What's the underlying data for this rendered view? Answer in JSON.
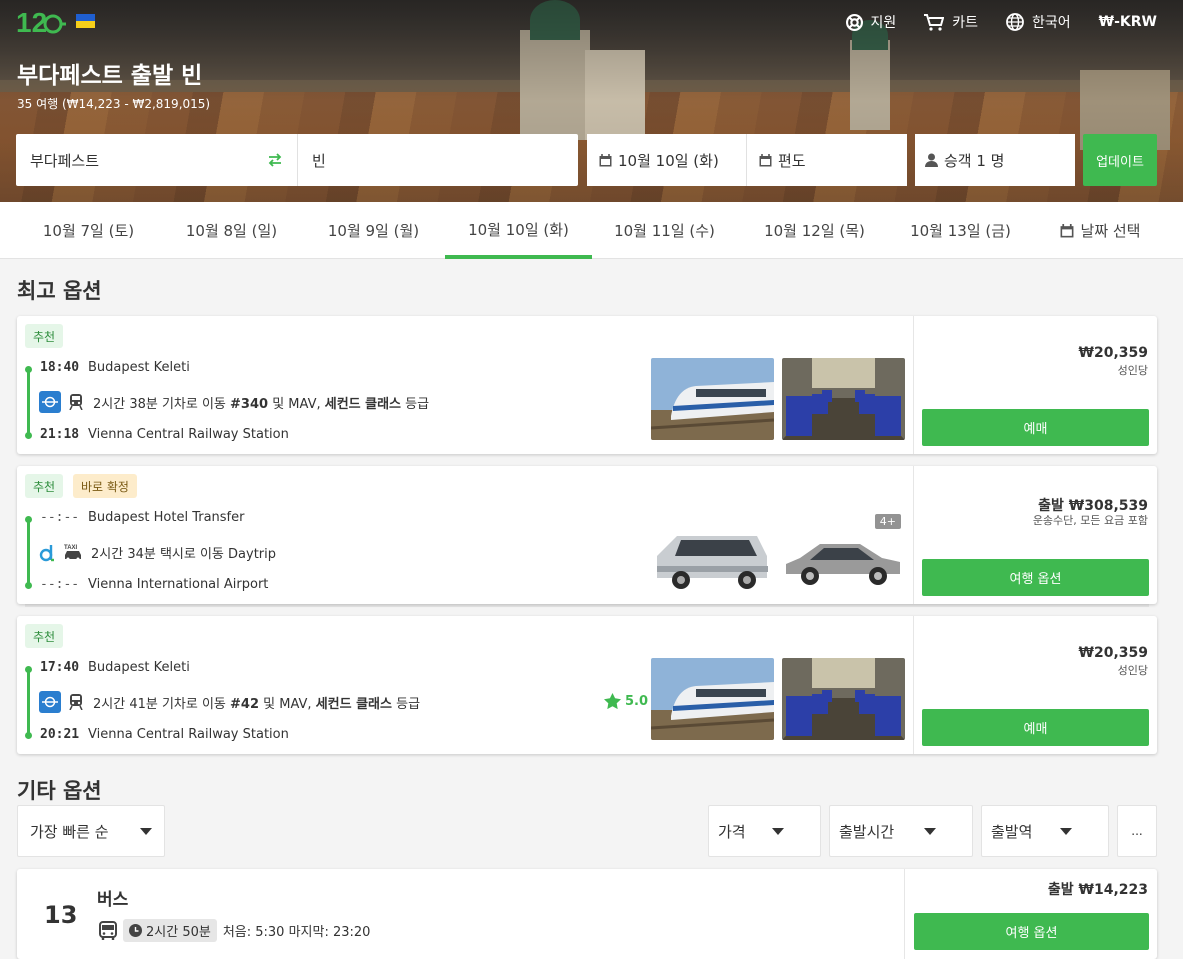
{
  "header": {
    "nav": [
      {
        "label": "지원",
        "icon": "lifebuoy-icon"
      },
      {
        "label": "카트",
        "icon": "cart-icon"
      },
      {
        "label": "한국어",
        "icon": "globe-icon"
      }
    ],
    "currency": "₩-KRW",
    "title": "부다페스트 출발 빈",
    "subtitle": "35 여행 (₩14,223 - ₩2,819,015)"
  },
  "search": {
    "from": "부다페스트",
    "to": "빈",
    "date": "10월 10일 (화)",
    "return": "편도",
    "passengers": "승객 1 명",
    "update_label": "업데이트"
  },
  "date_tabs": {
    "items": [
      "10월 7일 (토)",
      "10월 8일 (일)",
      "10월 9일 (월)",
      "10월 10일 (화)",
      "10월 11일 (수)",
      "10월 12일 (목)",
      "10월 13일 (금)"
    ],
    "active_index": 3,
    "pick_label": "날짜 선택"
  },
  "best_options": {
    "title": "최고 옵션",
    "cards": [
      {
        "badges": [
          "추천"
        ],
        "dep_time": "18:40",
        "dep_station": "Budapest Keleti",
        "arr_time": "21:18",
        "arr_station": "Vienna Central Railway Station",
        "duration": "2시간 38분 기차로 이동 ",
        "train_no": "#340",
        "operator_mid": " 및 MAV, ",
        "class_name": "세컨드 클래스",
        "class_suffix": " 등급",
        "price": "₩20,359",
        "price_note": "성인당",
        "button": "예매"
      },
      {
        "badges": [
          "추천",
          "바로 확정"
        ],
        "dep_time": "--:--",
        "dep_station": "Budapest Hotel Transfer",
        "arr_time": "--:--",
        "arr_station": "Vienna International Airport",
        "duration": "2시간 34분 택시로 이동 Daytrip",
        "extra_count": "4+",
        "price": "출발 ₩308,539",
        "price_note": "운송수단, 모든 요금 포함",
        "button": "여행 옵션"
      },
      {
        "badges": [
          "추천"
        ],
        "dep_time": "17:40",
        "dep_station": "Budapest Keleti",
        "arr_time": "20:21",
        "arr_station": "Vienna Central Railway Station",
        "duration": "2시간 41분 기차로 이동 ",
        "train_no": "#42",
        "operator_mid": " 및 MAV, ",
        "class_name": "세컨드 클래스",
        "class_suffix": " 등급",
        "rating": "5.0",
        "price": "₩20,359",
        "price_note": "성인당",
        "button": "예매"
      }
    ]
  },
  "other_options": {
    "title": "기타 옵션",
    "sort": "가장 빠른 순",
    "filters": [
      "가격",
      "출발시간",
      "출발역"
    ],
    "more": "...",
    "bus": {
      "count": "13",
      "title": "버스",
      "duration": "2시간 50분",
      "schedule": "처음: 5:30 마지막: 23:20",
      "price": "출발 ₩14,223",
      "button": "여행 옵션"
    }
  },
  "colors": {
    "accent": "#3fb950",
    "badge_green_bg": "#e5f6e8",
    "badge_yellow_bg": "#fdeccb"
  }
}
